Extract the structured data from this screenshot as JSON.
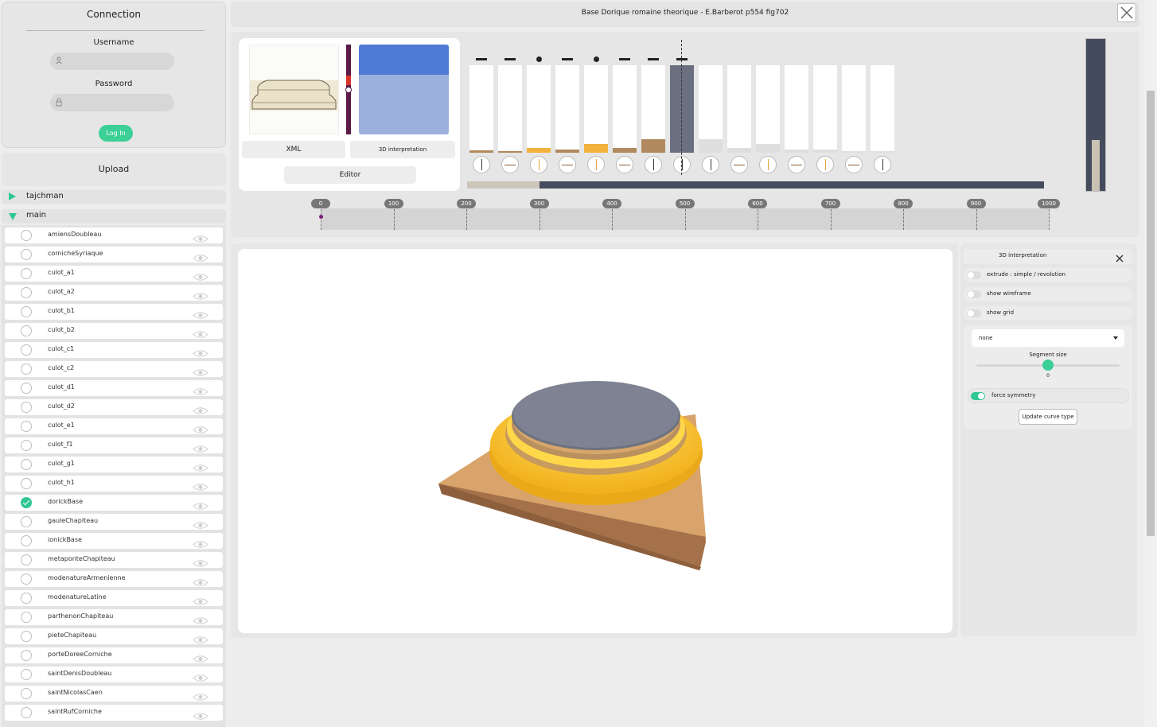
{
  "connection": {
    "title": "Connection",
    "username_label": "Username",
    "password_label": "Password",
    "username_value": "",
    "password_value": "",
    "login_label": "Log In"
  },
  "upload": {
    "label": "Upload"
  },
  "groups": [
    {
      "label": "tajchman",
      "expanded": false
    },
    {
      "label": "main",
      "expanded": true
    }
  ],
  "models": [
    {
      "name": "amiensDoubleau",
      "selected": false
    },
    {
      "name": "cornicheSyriaque",
      "selected": false
    },
    {
      "name": "culot_a1",
      "selected": false
    },
    {
      "name": "culot_a2",
      "selected": false
    },
    {
      "name": "culot_b1",
      "selected": false
    },
    {
      "name": "culot_b2",
      "selected": false
    },
    {
      "name": "culot_c1",
      "selected": false
    },
    {
      "name": "culot_c2",
      "selected": false
    },
    {
      "name": "culot_d1",
      "selected": false
    },
    {
      "name": "culot_d2",
      "selected": false
    },
    {
      "name": "culot_e1",
      "selected": false
    },
    {
      "name": "culot_f1",
      "selected": false
    },
    {
      "name": "culot_g1",
      "selected": false
    },
    {
      "name": "culot_h1",
      "selected": false
    },
    {
      "name": "dorickBase",
      "selected": true
    },
    {
      "name": "gauleChapiteau",
      "selected": false
    },
    {
      "name": "ionickBase",
      "selected": false
    },
    {
      "name": "metaponteChapiteau",
      "selected": false
    },
    {
      "name": "modenatureArmenienne",
      "selected": false
    },
    {
      "name": "modenatureLatine",
      "selected": false
    },
    {
      "name": "parthenonChapiteau",
      "selected": false
    },
    {
      "name": "pieteChapiteau",
      "selected": false
    },
    {
      "name": "porteDoreeCorniche",
      "selected": false
    },
    {
      "name": "saintDenisDoubleau",
      "selected": false
    },
    {
      "name": "saintNicolasCaen",
      "selected": false
    },
    {
      "name": "saintRufCorniche",
      "selected": false
    }
  ],
  "header": {
    "title": "Base Dorique romaine theorique - E.Barberot p554 fig702"
  },
  "card": {
    "xml_label": "XML",
    "interp_label": "3D interpretation",
    "editor_label": "Editor"
  },
  "segments": [
    {
      "marker": "dash",
      "fill": 0.03,
      "color": "#b08a5e",
      "knob": "v"
    },
    {
      "marker": "dash",
      "fill": 0.02,
      "color": "#b08a5e",
      "knob": "h"
    },
    {
      "marker": "dot",
      "fill": 0.05,
      "color": "#f3b13d",
      "knob": "vo"
    },
    {
      "marker": "dash",
      "fill": 0.04,
      "color": "#b08a5e",
      "knob": "h"
    },
    {
      "marker": "dot",
      "fill": 0.1,
      "color": "#f3b13d",
      "knob": "vo"
    },
    {
      "marker": "dash",
      "fill": 0.05,
      "color": "#b08a5e",
      "knob": "h"
    },
    {
      "marker": "dash",
      "fill": 0.15,
      "color": "#b08a5e",
      "knob": "v"
    },
    {
      "marker": "dash",
      "fill": 1.0,
      "color": "#6b7080",
      "knob": "v"
    },
    {
      "marker": "none",
      "fill": 0.15,
      "color": "#dedede",
      "knob": "v"
    },
    {
      "marker": "none",
      "fill": 0.05,
      "color": "#dedede",
      "knob": "h"
    },
    {
      "marker": "none",
      "fill": 0.1,
      "color": "#dedede",
      "knob": "vo"
    },
    {
      "marker": "none",
      "fill": 0.04,
      "color": "#dedede",
      "knob": "h"
    },
    {
      "marker": "none",
      "fill": 0.04,
      "color": "#dedede",
      "knob": "vo"
    },
    {
      "marker": "none",
      "fill": 0.02,
      "color": "#dedede",
      "knob": "h"
    },
    {
      "marker": "none",
      "fill": 0.02,
      "color": "#dedede",
      "knob": "v"
    }
  ],
  "progress": {
    "timeline_fraction": 0.125,
    "gauge_fraction": 0.33
  },
  "ruler": {
    "ticks": [
      "0",
      "100",
      "200",
      "300",
      "400",
      "500",
      "600",
      "700",
      "800",
      "900",
      "1000"
    ]
  },
  "interp_panel": {
    "title": "3D interpretation",
    "options": [
      {
        "label": "extrude : simple / revolution",
        "on": false
      },
      {
        "label": "show wireframe",
        "on": false
      },
      {
        "label": "show grid",
        "on": false
      }
    ],
    "curve_type": "none",
    "segment_size_label": "Segment size",
    "segment_size_value": "0",
    "force_symmetry_label": "force symmetry",
    "force_symmetry_on": true,
    "update_label": "Update curve type"
  },
  "colors": {
    "accent": "#2fc795",
    "base_block": "#d9a36b",
    "torus": "#ffd23a",
    "fillet": "#d6ad74",
    "top_disc": "#7e8293"
  },
  "icons": [
    "user-icon",
    "lock-icon",
    "eye-icon",
    "close-icon",
    "chevron-down-icon",
    "triangle-right-icon",
    "triangle-down-icon"
  ]
}
